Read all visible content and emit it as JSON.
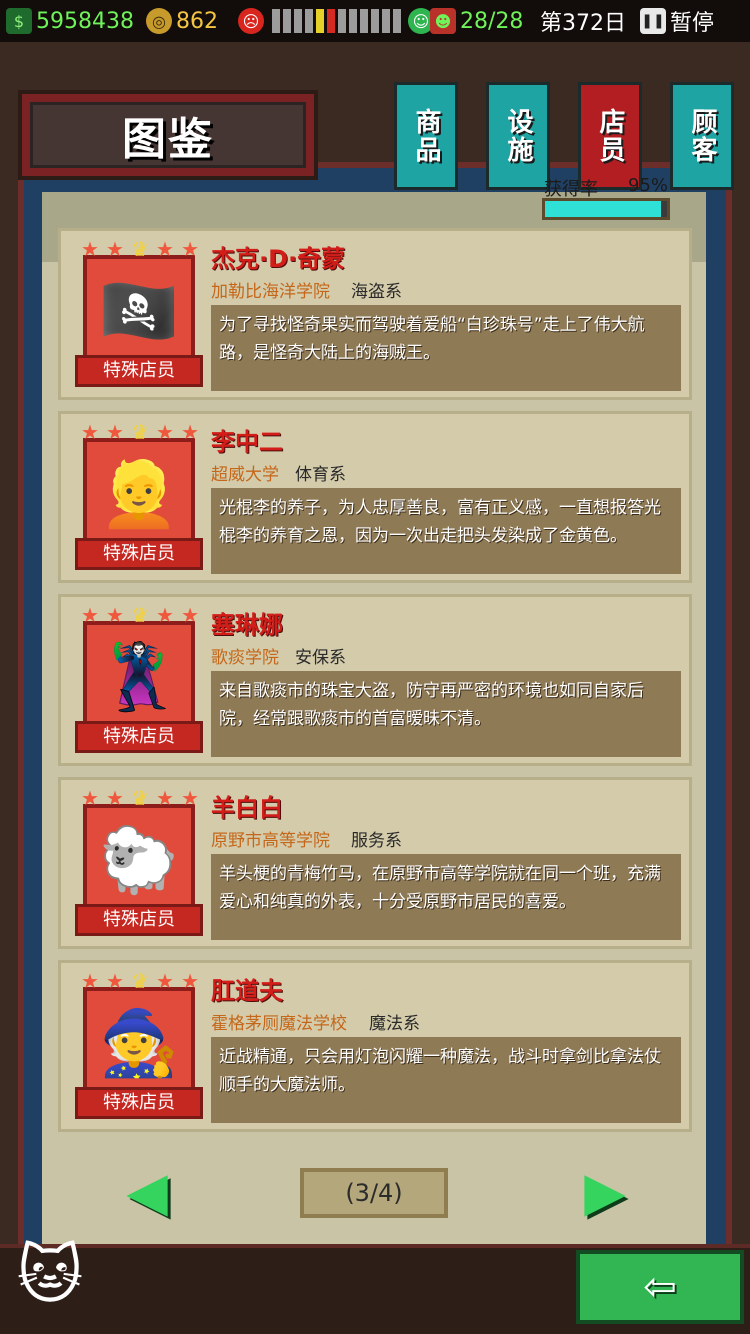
{
  "topbar": {
    "money": "5958438",
    "coins": "862",
    "staff_count": "28/28",
    "day": "第372日",
    "pause_label": "暂停",
    "mood_level": 0.4
  },
  "icons": {
    "money": "cash-icon",
    "coins": "coin-icon",
    "mood_bad": "angry-face-icon",
    "mood_good": "happy-face-icon",
    "staff": "staff-avatar-icon",
    "pause": "pause-icon",
    "back": "back-arrow-icon"
  },
  "title": "图鉴",
  "tabs": [
    {
      "label": "商品",
      "active": false
    },
    {
      "label": "设施",
      "active": false
    },
    {
      "label": "店员",
      "active": true
    },
    {
      "label": "顾客",
      "active": false
    }
  ],
  "rate": {
    "label": "获得率",
    "value": "95%",
    "fraction": 0.95
  },
  "cards": [
    {
      "name": "杰克·D·奇蒙",
      "school": "加勒比海洋学院",
      "dept": "海盗系",
      "ribbon": "特殊店员",
      "desc": "为了寻找怪奇果实而驾驶着爱船“白珍珠号”走上了伟大航路，是怪奇大陆上的海贼王。",
      "stars": 5
    },
    {
      "name": "李中二",
      "school": "超威大学",
      "dept": "体育系",
      "ribbon": "特殊店员",
      "desc": "光棍李的养子，为人忠厚善良，富有正义感，一直想报答光棍李的养育之恩，因为一次出走把头发染成了金黄色。",
      "stars": 5
    },
    {
      "name": "塞琳娜",
      "school": "歌痰学院",
      "dept": "安保系",
      "ribbon": "特殊店员",
      "desc": "来自歌痰市的珠宝大盗，防守再严密的环境也如同自家后院，经常跟歌痰市的首富暧昧不清。",
      "stars": 5
    },
    {
      "name": "羊白白",
      "school": "原野市高等学院",
      "dept": "服务系",
      "ribbon": "特殊店员",
      "desc": "羊头梗的青梅竹马，在原野市高等学院就在同一个班，充满爱心和纯真的外表，十分受原野市居民的喜爱。",
      "stars": 5
    },
    {
      "name": "肛道夫",
      "school": "霍格茅厕魔法学校",
      "dept": "魔法系",
      "ribbon": "特殊店员",
      "desc": "近战精通，只会用灯泡闪耀一种魔法，战斗时拿剑比拿法仗顺手的大魔法师。",
      "stars": 5
    }
  ],
  "pagination": {
    "label": "(3/4)"
  }
}
